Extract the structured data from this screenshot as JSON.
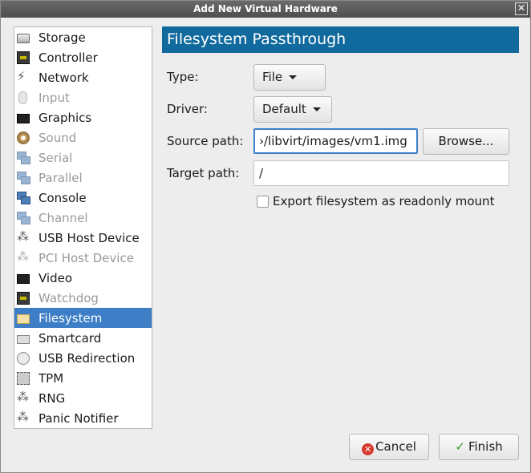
{
  "window": {
    "title": "Add New Virtual Hardware",
    "close_glyph": "✕"
  },
  "sidebar": {
    "items": [
      {
        "label": "Storage",
        "icon": "disk-icon",
        "enabled": true
      },
      {
        "label": "Controller",
        "icon": "chip-icon",
        "enabled": true
      },
      {
        "label": "Network",
        "icon": "plug-icon",
        "enabled": true
      },
      {
        "label": "Input",
        "icon": "mouse-icon",
        "enabled": false
      },
      {
        "label": "Graphics",
        "icon": "monitor-icon",
        "enabled": true
      },
      {
        "label": "Sound",
        "icon": "speaker-icon",
        "enabled": false
      },
      {
        "label": "Serial",
        "icon": "serial-icon",
        "enabled": false
      },
      {
        "label": "Parallel",
        "icon": "serial-icon",
        "enabled": false
      },
      {
        "label": "Console",
        "icon": "serial-icon",
        "enabled": true
      },
      {
        "label": "Channel",
        "icon": "serial-icon",
        "enabled": false
      },
      {
        "label": "USB Host Device",
        "icon": "usb-icon",
        "enabled": true
      },
      {
        "label": "PCI Host Device",
        "icon": "usb-icon",
        "enabled": false
      },
      {
        "label": "Video",
        "icon": "monitor-icon",
        "enabled": true
      },
      {
        "label": "Watchdog",
        "icon": "chip-icon",
        "enabled": false
      },
      {
        "label": "Filesystem",
        "icon": "folder-icon",
        "enabled": true,
        "selected": true
      },
      {
        "label": "Smartcard",
        "icon": "smartcard-icon",
        "enabled": true
      },
      {
        "label": "USB Redirection",
        "icon": "usb-redirection-icon",
        "enabled": true
      },
      {
        "label": "TPM",
        "icon": "tpm-icon",
        "enabled": true
      },
      {
        "label": "RNG",
        "icon": "usb-icon",
        "enabled": true
      },
      {
        "label": "Panic Notifier",
        "icon": "usb-icon",
        "enabled": true
      }
    ]
  },
  "panel": {
    "title": "Filesystem Passthrough",
    "type_label": "Type:",
    "type_value": "File",
    "driver_label": "Driver:",
    "driver_value": "Default",
    "source_label": "Source path:",
    "source_value": "›/libvirt/images/vm1.img",
    "browse_label": "Browse...",
    "target_label": "Target path:",
    "target_value": "/",
    "readonly_label": "Export filesystem as readonly mount",
    "readonly_checked": false
  },
  "footer": {
    "cancel_label": "Cancel",
    "finish_label": "Finish"
  },
  "colors": {
    "selection": "#3d7ec6",
    "header": "#116a9e"
  }
}
